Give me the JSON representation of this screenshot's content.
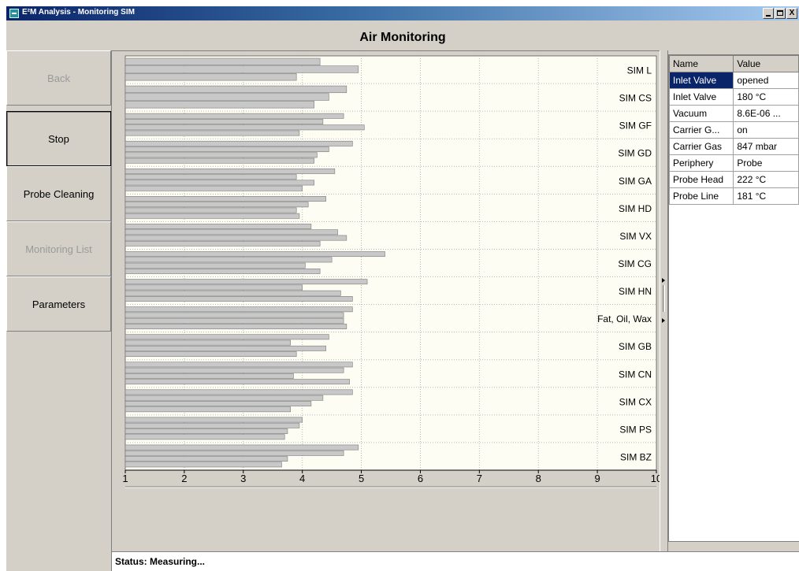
{
  "window": {
    "title": "E²M Analysis - Monitoring SIM",
    "minimize_label": "_",
    "close_label": "X"
  },
  "header": {
    "title": "Air Monitoring"
  },
  "nav": {
    "back": "Back",
    "stop": "Stop",
    "probe_cleaning": "Probe Cleaning",
    "monitoring_list": "Monitoring List",
    "parameters": "Parameters"
  },
  "properties": {
    "headers": [
      "Name",
      "Value"
    ],
    "rows": [
      {
        "name": "Inlet Valve",
        "value": "opened"
      },
      {
        "name": "Inlet Valve",
        "value": "180 °C"
      },
      {
        "name": "Vacuum",
        "value": "8.6E-06 ..."
      },
      {
        "name": "Carrier G...",
        "value": "on"
      },
      {
        "name": "Carrier Gas",
        "value": "847 mbar"
      },
      {
        "name": "Periphery",
        "value": "Probe"
      },
      {
        "name": "Probe Head",
        "value": "222 °C"
      },
      {
        "name": "Probe Line",
        "value": "181 °C"
      }
    ]
  },
  "status": {
    "text": "Status: Measuring..."
  },
  "colors": {
    "bar_fill": "#c8c8c8",
    "bar_stroke": "#7a7a7a",
    "plot_background": "#fdfdf3",
    "selection": "#0a246a"
  },
  "chart_data": {
    "type": "bar",
    "orientation": "horizontal",
    "xlim": [
      1,
      10
    ],
    "x_ticks": [
      "1",
      "2",
      "3",
      "4",
      "5",
      "6",
      "7",
      "8",
      "9",
      "10"
    ],
    "grid": true,
    "categories": [
      "SIM L",
      "SIM CS",
      "SIM GF",
      "SIM GD",
      "SIM GA",
      "SIM HD",
      "SIM VX",
      "SIM CG",
      "SIM HN",
      "Fat, Oil, Wax",
      "SIM GB",
      "SIM CN",
      "SIM CX",
      "SIM PS",
      "SIM BZ"
    ],
    "values": [
      [
        4.3,
        4.95,
        3.9
      ],
      [
        4.75,
        4.45,
        4.2
      ],
      [
        4.7,
        4.35,
        5.05,
        3.95
      ],
      [
        4.85,
        4.45,
        4.25,
        4.2
      ],
      [
        4.55,
        3.9,
        4.2,
        4.0
      ],
      [
        4.4,
        4.1,
        3.9,
        3.95
      ],
      [
        4.15,
        4.6,
        4.75,
        4.3
      ],
      [
        5.4,
        4.5,
        4.05,
        4.3
      ],
      [
        5.1,
        4.0,
        4.65,
        4.85
      ],
      [
        4.85,
        4.7,
        4.7,
        4.75
      ],
      [
        4.45,
        3.8,
        4.4,
        3.9
      ],
      [
        4.85,
        4.7,
        3.85,
        4.8
      ],
      [
        4.85,
        4.35,
        4.15,
        3.8
      ],
      [
        4.0,
        3.95,
        3.75,
        3.7
      ],
      [
        4.95,
        4.7,
        3.75,
        3.65
      ]
    ]
  }
}
